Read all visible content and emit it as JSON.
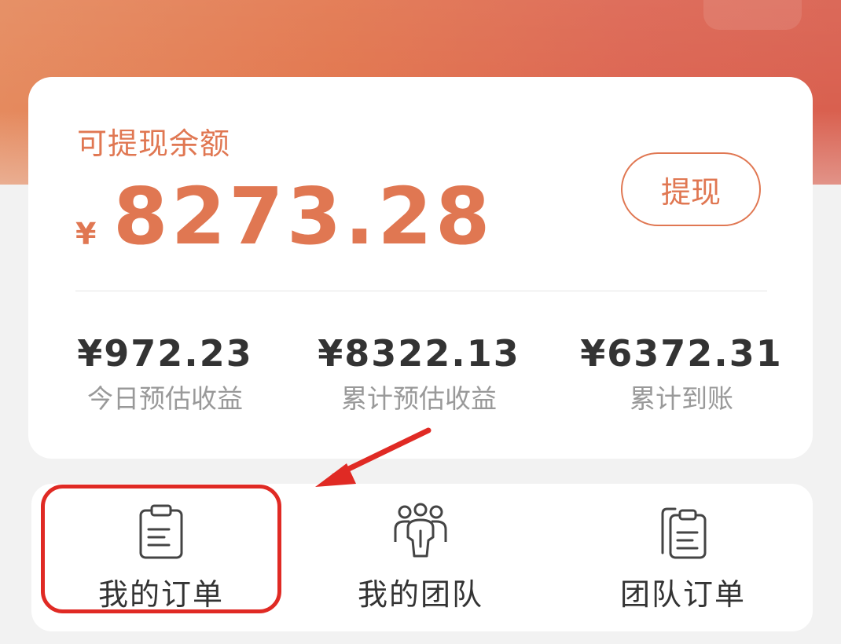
{
  "balance_card": {
    "label": "可提现余额",
    "currency": "¥",
    "amount": "8273.28",
    "withdraw_label": "提现"
  },
  "stats": [
    {
      "value": "¥972.23",
      "label": "今日预估收益"
    },
    {
      "value": "¥8322.13",
      "label": "累计预估收益"
    },
    {
      "value": "¥6372.31",
      "label": "累计到账"
    }
  ],
  "menu": [
    {
      "label": "我的订单",
      "icon": "clipboard-icon"
    },
    {
      "label": "我的团队",
      "icon": "team-icon"
    },
    {
      "label": "团队订单",
      "icon": "team-orders-icon"
    }
  ],
  "colors": {
    "accent": "#e07752",
    "highlight": "#e02a24",
    "header_gradient_start": "#e58a5e",
    "header_gradient_end": "#d9604f"
  }
}
